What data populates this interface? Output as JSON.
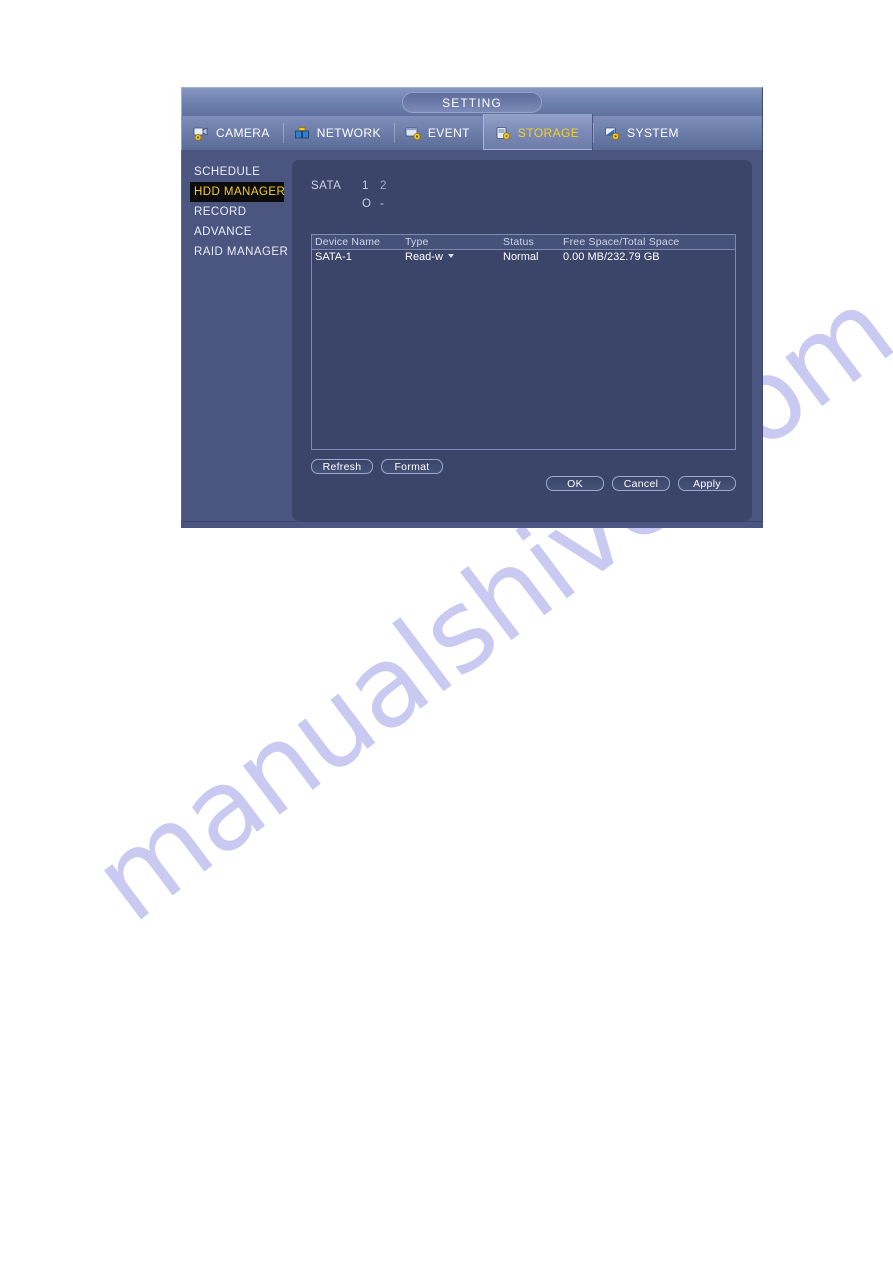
{
  "dialog": {
    "title": "SETTING",
    "tabs": [
      {
        "label": "CAMERA",
        "icon": "camera-icon",
        "active": false
      },
      {
        "label": "NETWORK",
        "icon": "network-icon",
        "active": false
      },
      {
        "label": "EVENT",
        "icon": "event-icon",
        "active": false
      },
      {
        "label": "STORAGE",
        "icon": "storage-icon",
        "active": true
      },
      {
        "label": "SYSTEM",
        "icon": "system-icon",
        "active": false
      }
    ],
    "sidebar": {
      "items": [
        {
          "label": "SCHEDULE",
          "selected": false
        },
        {
          "label": "HDD MANAGER",
          "selected": true
        },
        {
          "label": "RECORD",
          "selected": false
        },
        {
          "label": "ADVANCE",
          "selected": false
        },
        {
          "label": "RAID MANAGER",
          "selected": false
        }
      ]
    },
    "sata": {
      "label": "SATA",
      "slots": [
        {
          "number": "1",
          "state": "O"
        },
        {
          "number": "2",
          "state": "-"
        }
      ]
    },
    "table": {
      "columns": [
        "Device Name",
        "Type",
        "Status",
        "Free Space/Total Space"
      ],
      "rows": [
        {
          "device_name": "SATA-1",
          "type": "Read-w",
          "status": "Normal",
          "space": "0.00 MB/232.79 GB"
        }
      ]
    },
    "left_buttons": [
      "Refresh",
      "Format"
    ],
    "right_buttons": [
      "OK",
      "Cancel",
      "Apply"
    ],
    "colors": {
      "accent_yellow": "#f5d020",
      "dialog_bg": "#4a5680",
      "panel_bg": "#3b4569",
      "selected_bg": "#0c0c0c",
      "border": "#7c8ab4"
    }
  },
  "watermark": {
    "text": "manualshive.com",
    "color": "#c9c9f2"
  }
}
